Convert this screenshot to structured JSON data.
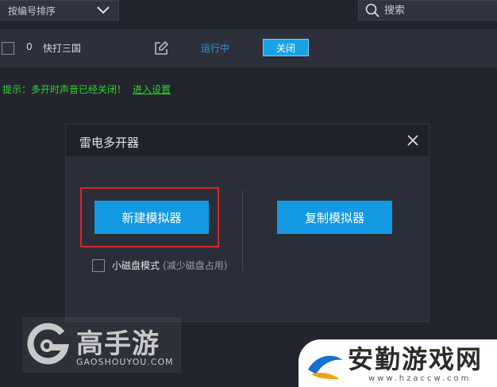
{
  "toolbar": {
    "sort_label": "按编号排序",
    "search_placeholder": "搜索"
  },
  "instances": [
    {
      "index": "0",
      "name": "快打三国",
      "status": "运行中",
      "action": "关闭"
    }
  ],
  "tip": {
    "text": "提示：多开时声音已经关闭！",
    "link": "进入设置"
  },
  "dialog": {
    "title": "雷电多开器",
    "new_button": "新建模拟器",
    "copy_button": "复制模拟器",
    "small_disk_label": "小磁盘模式",
    "small_disk_note": "(减少磁盘占用)"
  },
  "watermarks": {
    "left_cn": "高手游",
    "left_en": "GAOSHOUYOU.COM",
    "right_cn": "安勤游戏网",
    "right_en": "www.hzaccw.com"
  },
  "colors": {
    "background": "#23252e",
    "accent": "#1499e3",
    "status": "#2f96d6",
    "tip": "#2bd62b",
    "highlight": "#d9262c"
  }
}
